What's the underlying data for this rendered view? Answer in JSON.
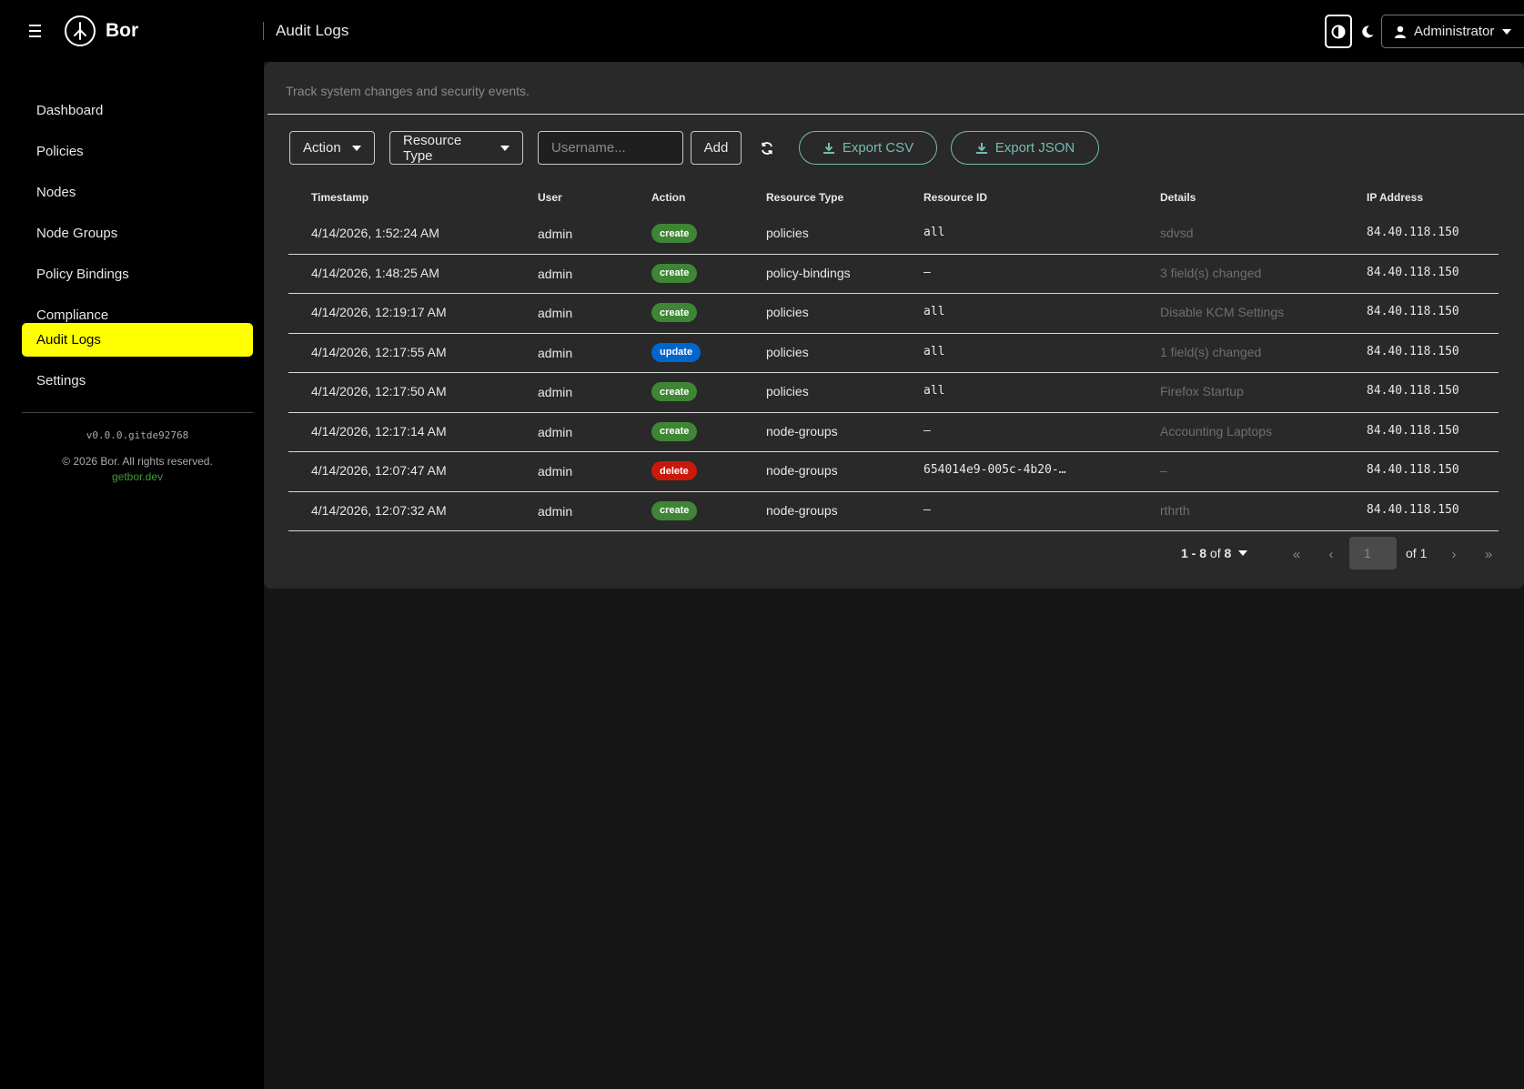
{
  "app": {
    "name": "Bor",
    "page_title": "Audit Logs"
  },
  "header": {
    "user_label": "Administrator"
  },
  "sidebar": {
    "items": [
      {
        "label": "Dashboard",
        "active": false
      },
      {
        "label": "Policies",
        "active": false
      },
      {
        "label": "Nodes",
        "active": false
      },
      {
        "label": "Node Groups",
        "active": false
      },
      {
        "label": "Policy Bindings",
        "active": false
      },
      {
        "label": "Compliance",
        "active": false
      },
      {
        "label": "Audit Logs",
        "active": true
      },
      {
        "label": "Settings",
        "active": false
      }
    ],
    "version": "v0.0.0.gitde92768",
    "copyright": "© 2026 Bor. All rights reserved.",
    "link": "getbor.dev"
  },
  "main": {
    "description": "Track system changes and security events.",
    "filters": {
      "action_label": "Action",
      "resource_type_label": "Resource Type",
      "username_placeholder": "Username...",
      "add_label": "Add",
      "export_csv_label": "Export CSV",
      "export_json_label": "Export JSON"
    },
    "columns": [
      "Timestamp",
      "User",
      "Action",
      "Resource Type",
      "Resource ID",
      "Details",
      "IP Address"
    ],
    "rows": [
      {
        "timestamp": "4/14/2026, 1:52:24 AM",
        "user": "admin",
        "action": "create",
        "resource_type": "policies",
        "resource_id": "all",
        "details": "sdvsd",
        "ip": "84.40.118.150"
      },
      {
        "timestamp": "4/14/2026, 1:48:25 AM",
        "user": "admin",
        "action": "create",
        "resource_type": "policy-bindings",
        "resource_id": "–",
        "details": "3 field(s) changed",
        "ip": "84.40.118.150"
      },
      {
        "timestamp": "4/14/2026, 12:19:17 AM",
        "user": "admin",
        "action": "create",
        "resource_type": "policies",
        "resource_id": "all",
        "details": "Disable KCM Settings",
        "ip": "84.40.118.150"
      },
      {
        "timestamp": "4/14/2026, 12:17:55 AM",
        "user": "admin",
        "action": "update",
        "resource_type": "policies",
        "resource_id": "all",
        "details": "1 field(s) changed",
        "ip": "84.40.118.150"
      },
      {
        "timestamp": "4/14/2026, 12:17:50 AM",
        "user": "admin",
        "action": "create",
        "resource_type": "policies",
        "resource_id": "all",
        "details": "Firefox Startup",
        "ip": "84.40.118.150"
      },
      {
        "timestamp": "4/14/2026, 12:17:14 AM",
        "user": "admin",
        "action": "create",
        "resource_type": "node-groups",
        "resource_id": "–",
        "details": "Accounting Laptops",
        "ip": "84.40.118.150"
      },
      {
        "timestamp": "4/14/2026, 12:07:47 AM",
        "user": "admin",
        "action": "delete",
        "resource_type": "node-groups",
        "resource_id": "654014e9-005c-4b20-…",
        "details": "–",
        "ip": "84.40.118.150"
      },
      {
        "timestamp": "4/14/2026, 12:07:32 AM",
        "user": "admin",
        "action": "create",
        "resource_type": "node-groups",
        "resource_id": "–",
        "details": "rthrth",
        "ip": "84.40.118.150"
      }
    ],
    "pagination": {
      "range": "1 - 8",
      "of_word": "of",
      "total": "8",
      "current_page": "1",
      "of_pages": "of 1"
    }
  },
  "colors": {
    "active_nav": "#ffff00",
    "create": "#3e8635",
    "update": "#0066cc",
    "delete": "#c9190b",
    "export_accent": "#73bcb0",
    "link": "#3f9c35"
  }
}
